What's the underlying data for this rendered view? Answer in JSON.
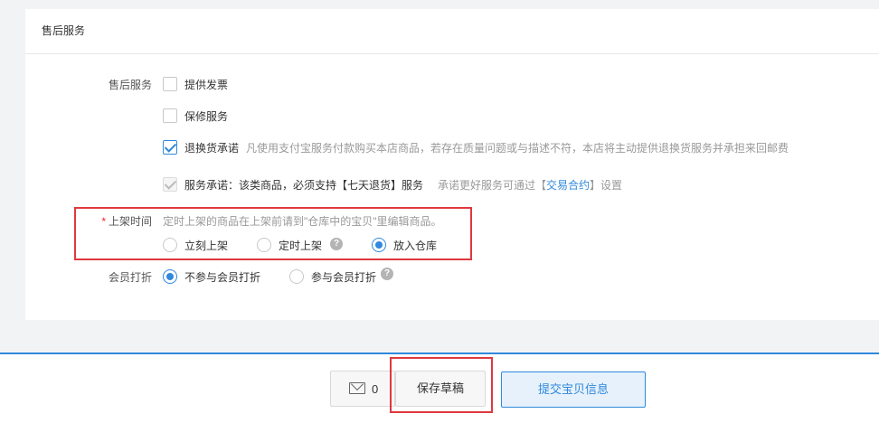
{
  "section": {
    "title": "售后服务"
  },
  "after_sales": {
    "label": "售后服务",
    "options": [
      {
        "label": "提供发票",
        "checked": false
      },
      {
        "label": "保修服务",
        "checked": false
      },
      {
        "label": "退换货承诺",
        "checked": true,
        "note": "凡使用支付宝服务付款购买本店商品，若存在质量问题或与描述不符，本店将主动提供退换货服务并承担来回邮费"
      }
    ],
    "promise": {
      "label": "服务承诺：该类商品，必须支持【七天退货】服务",
      "note_prefix": "承诺更好服务可通过【",
      "note_link": "交易合约",
      "note_suffix": "】设置"
    }
  },
  "listing_time": {
    "required_mark": "*",
    "label": "上架时间",
    "hint": "定时上架的商品在上架前请到\"仓库中的宝贝\"里编辑商品。",
    "options": [
      {
        "label": "立刻上架",
        "checked": false
      },
      {
        "label": "定时上架",
        "checked": false,
        "help": "?"
      },
      {
        "label": "放入仓库",
        "checked": true
      }
    ]
  },
  "member_discount": {
    "label": "会员打折",
    "options": [
      {
        "label": "不参与会员打折",
        "checked": true
      },
      {
        "label": "参与会员打折",
        "checked": false,
        "help": "?"
      }
    ]
  },
  "footer": {
    "message_count": "0",
    "save_draft": "保存草稿",
    "submit": "提交宝贝信息"
  },
  "colors": {
    "accent": "#3089dc",
    "highlight": "#e0383e"
  }
}
